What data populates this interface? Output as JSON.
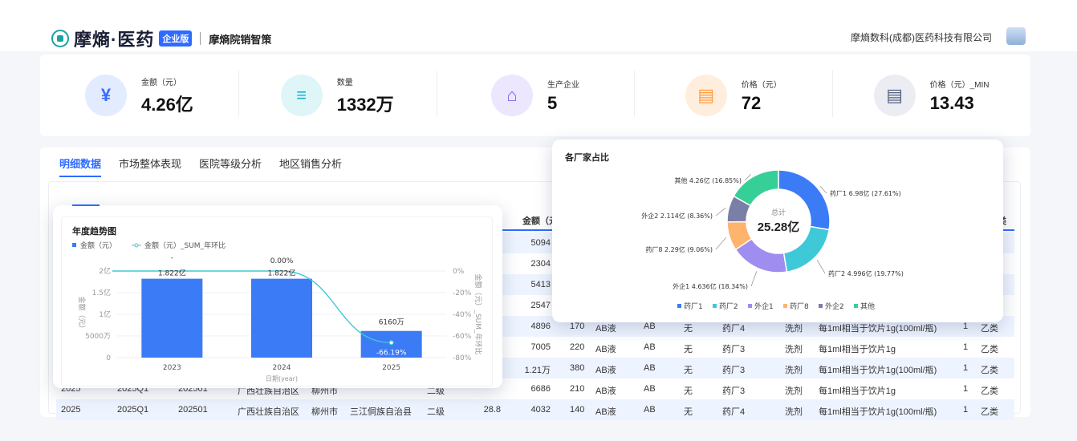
{
  "header": {
    "brand": "摩熵·医药",
    "edition_badge": "企业版",
    "product_name": "摩熵院销智策",
    "company": "摩熵数科(成都)医药科技有限公司"
  },
  "kpis": [
    {
      "label": "金额（元）",
      "value": "4.26亿",
      "icon": "yuan-icon",
      "glyph": "¥",
      "bg": "#e3ebff",
      "fg": "#3a6bff"
    },
    {
      "label": "数量",
      "value": "1332万",
      "icon": "database-icon",
      "glyph": "≡",
      "bg": "#dff6f9",
      "fg": "#18b6c9"
    },
    {
      "label": "生产企业",
      "value": "5",
      "icon": "home-icon",
      "glyph": "⌂",
      "bg": "#ece6ff",
      "fg": "#7b5cf0"
    },
    {
      "label": "价格（元）",
      "value": "72",
      "icon": "price-doc-icon",
      "glyph": "▤",
      "bg": "#ffeede",
      "fg": "#ff9a3c"
    },
    {
      "label": "价格（元）_MIN",
      "value": "13.43",
      "icon": "price-min-doc-icon",
      "glyph": "▤",
      "bg": "#ebedf2",
      "fg": "#556080"
    }
  ],
  "tabs": [
    "明细数据",
    "市场整体表现",
    "医院等级分析",
    "地区销售分析"
  ],
  "table": {
    "headers": [
      "金额（元）",
      "类"
    ],
    "rows": [
      {
        "amount": "5094"
      },
      {
        "amount": "2304"
      },
      {
        "amount": "5413"
      },
      {
        "amount": "2547"
      },
      {
        "amount": "4896",
        "qty": "170",
        "form": "AB液",
        "code": "AB",
        "flag": "无",
        "maker": "药厂4",
        "kind": "洗剂",
        "spec": "每1ml相当于饮片1g(100ml/瓶)",
        "n": "1",
        "cls": "乙类"
      },
      {
        "amount": "7005",
        "qty": "220",
        "form": "AB液",
        "code": "AB",
        "flag": "无",
        "maker": "药厂3",
        "kind": "洗剂",
        "spec": "每1ml相当于饮片1g",
        "n": "1",
        "cls": "乙类"
      },
      {
        "amount": "1.21万",
        "qty": "380",
        "form": "AB液",
        "code": "AB",
        "flag": "无",
        "maker": "药厂3",
        "kind": "洗剂",
        "spec": "每1ml相当于饮片1g(100ml/瓶)",
        "n": "1",
        "cls": "乙类"
      },
      {
        "year": "2025",
        "quarter": "2025Q1",
        "month": "202501",
        "province": "广西壮族自治区",
        "city": "柳州市",
        "county": "",
        "grade": "二级",
        "price": "",
        "amount": "6686",
        "qty": "210",
        "form": "AB液",
        "code": "AB",
        "flag": "无",
        "maker": "药厂3",
        "kind": "洗剂",
        "spec": "每1ml相当于饮片1g",
        "n": "1",
        "cls": "乙类"
      },
      {
        "year": "2025",
        "quarter": "2025Q1",
        "month": "202501",
        "province": "广西壮族自治区",
        "city": "柳州市",
        "county": "三江侗族自治县",
        "grade": "二级",
        "price": "28.8",
        "amount": "4032",
        "qty": "140",
        "form": "AB液",
        "code": "AB",
        "flag": "无",
        "maker": "药厂4",
        "kind": "洗剂",
        "spec": "每1ml相当于饮片1g(100ml/瓶)",
        "n": "1",
        "cls": "乙类"
      }
    ]
  },
  "chart_data": [
    {
      "type": "bar",
      "title": "年度趋势图",
      "categories": [
        "2023",
        "2024",
        "2025"
      ],
      "xlabel": "日期(year)",
      "ylabel": "金额（元）",
      "y2label": "金额（元）_SUM_年环比",
      "ylim": [
        0,
        200000000
      ],
      "yticks": [
        "0",
        "5000万",
        "1亿",
        "1.5亿",
        "2亿"
      ],
      "y2lim": [
        -80,
        0
      ],
      "y2ticks": [
        "0%",
        "-20%",
        "-40%",
        "-60%",
        "-80%"
      ],
      "legend": [
        "金额（元）",
        "金额（元）_SUM_年环比"
      ],
      "series": [
        {
          "name": "金额（元）",
          "kind": "bar",
          "values": [
            182200000,
            182200000,
            61600000
          ],
          "labels": [
            "1.822亿",
            "1.822亿",
            "6160万"
          ],
          "color": "#3b7bf5"
        },
        {
          "name": "金额（元）_SUM_年环比",
          "kind": "line",
          "values": [
            null,
            0.0,
            -66.19
          ],
          "labels": [
            "-",
            "0.00%",
            "-66.19%"
          ],
          "color": "#3fc8d8"
        }
      ]
    },
    {
      "type": "pie",
      "title": "各厂家占比",
      "center_label": "总计",
      "center_value": "25.28亿",
      "slices": [
        {
          "name": "药厂1",
          "label": "药厂1 6.98亿 (27.61%)",
          "value": 27.61,
          "color": "#3b7bf5"
        },
        {
          "name": "药厂2",
          "label": "药厂2 4.996亿 (19.77%)",
          "value": 19.77,
          "color": "#3fc8d8"
        },
        {
          "name": "外企1",
          "label": "外企1 4.636亿 (18.34%)",
          "value": 18.34,
          "color": "#a08df0"
        },
        {
          "name": "药厂8",
          "label": "药厂8 2.29亿 (9.06%)",
          "value": 9.06,
          "color": "#ffb46e"
        },
        {
          "name": "外企2",
          "label": "外企2 2.114亿 (8.36%)",
          "value": 8.36,
          "color": "#7a7fa8"
        },
        {
          "name": "其他",
          "label": "其他 4.26亿 (16.85%)",
          "value": 16.85,
          "color": "#36cf98"
        }
      ]
    }
  ]
}
